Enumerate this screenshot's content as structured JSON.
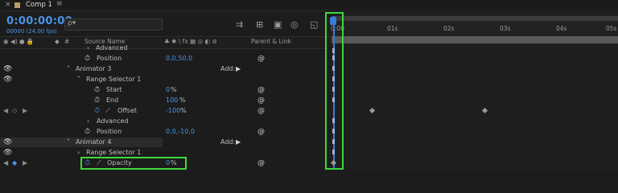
{
  "tab": {
    "close": "×",
    "title": "Comp 1",
    "menu": "≡"
  },
  "header": {
    "timecode": "0:00:00:00",
    "frames": "00000 (24.00 fps)",
    "search_placeholder": "ρ▾"
  },
  "toolbar_icons": [
    "render-queue-icon",
    "composition-flow-icon",
    "draft-3d-icon",
    "motion-blur-icon",
    "graph-editor-icon"
  ],
  "columns": {
    "source_name": "Source Name",
    "number": "#",
    "parent_link": "Parent & Link",
    "switches": "♣ ✱ \\ fx ▦ ◎ ◐ ⊚"
  },
  "ruler": {
    "ticks": [
      "0:00",
      "01s",
      "02s",
      "03s",
      "04s",
      "05s"
    ]
  },
  "rows": [
    {
      "label": "Advanced",
      "indent": 1,
      "twirl": "›"
    },
    {
      "label": "Position",
      "value": "0,0,50,0",
      "stopwatch": true
    },
    {
      "label": "Animator 3",
      "twirl": "˅",
      "add": "Add:"
    },
    {
      "label": "Range Selector 1",
      "twirl": "˅"
    },
    {
      "label": "Start",
      "value": "0",
      "unit": "%",
      "stopwatch": true
    },
    {
      "label": "End",
      "value": "100",
      "unit": "%",
      "stopwatch": true
    },
    {
      "label": "Offset",
      "value": "-100",
      "unit": "%",
      "stopwatch": true,
      "keyed": true
    },
    {
      "label": "Advanced",
      "twirl": "›"
    },
    {
      "label": "Position",
      "value": "0,0,-10,0",
      "stopwatch": true
    },
    {
      "label": "Animator 4",
      "twirl": "˅",
      "add": "Add:"
    },
    {
      "label": "Range Selector 1",
      "twirl": "›"
    },
    {
      "label": "Opacity",
      "value": "0",
      "unit": "%",
      "stopwatch": true,
      "keyed": true
    }
  ],
  "colors": {
    "accent": "#4b95e6",
    "highlight_box": "#3ed83e",
    "cti": "#3d7bd8"
  }
}
